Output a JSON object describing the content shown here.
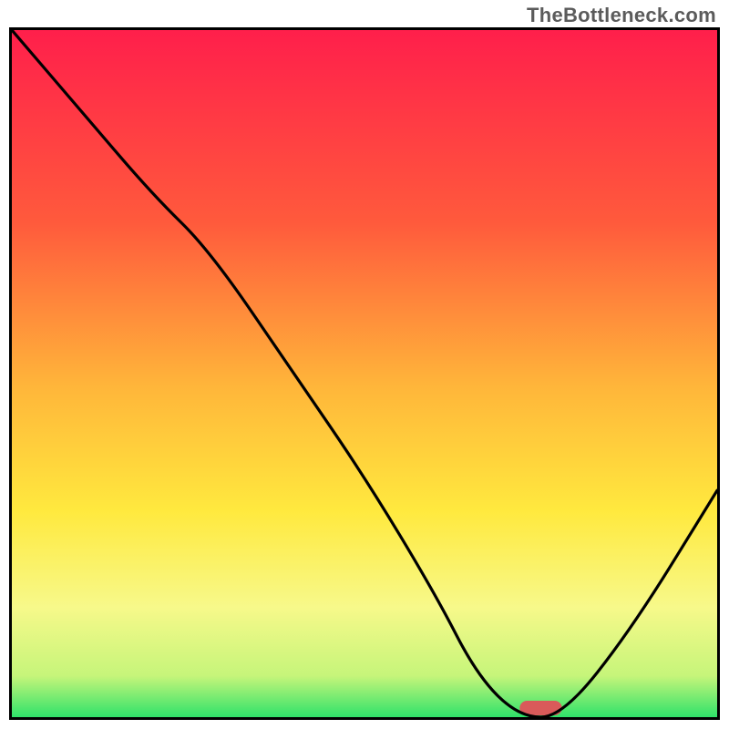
{
  "watermark": "TheBottleneck.com",
  "chart_data": {
    "type": "line",
    "title": "",
    "xlabel": "",
    "ylabel": "",
    "xlim": [
      0,
      100
    ],
    "ylim": [
      0,
      100
    ],
    "x": [
      0,
      10,
      20,
      28,
      40,
      50,
      60,
      66,
      72,
      78,
      88,
      100
    ],
    "values": [
      100,
      88,
      76,
      68,
      50,
      35,
      18,
      6,
      0,
      0,
      13,
      33
    ],
    "optimum_marker": {
      "x": 75,
      "width": 6
    },
    "gradient_stops": [
      {
        "pct": 0,
        "color": "#ff1f4b"
      },
      {
        "pct": 28,
        "color": "#ff5a3c"
      },
      {
        "pct": 52,
        "color": "#ffb63a"
      },
      {
        "pct": 70,
        "color": "#ffe93e"
      },
      {
        "pct": 84,
        "color": "#f7f98a"
      },
      {
        "pct": 94,
        "color": "#c6f57a"
      },
      {
        "pct": 100,
        "color": "#2fe26a"
      }
    ]
  }
}
